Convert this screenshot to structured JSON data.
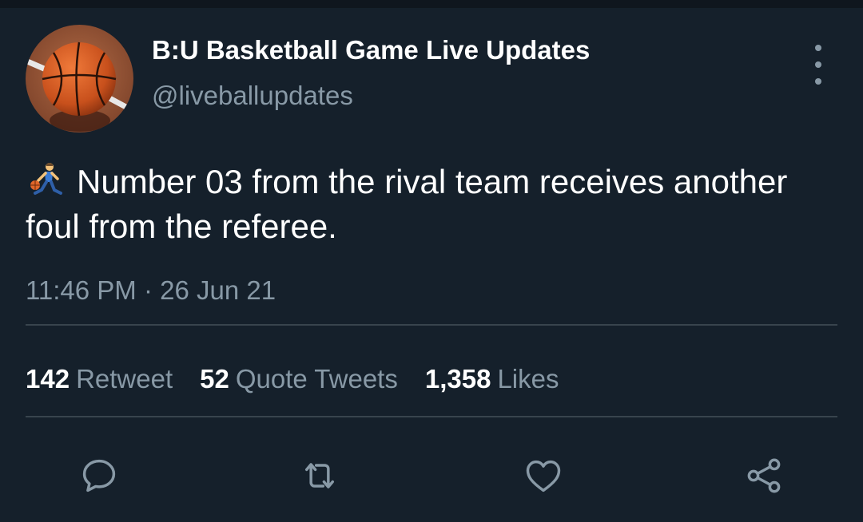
{
  "tweet": {
    "display_name": "B:U Basketball Game Live Updates",
    "handle": "@liveballupdates",
    "emoji_icon": "person-bouncing-ball-icon",
    "text": "Number 03 from the rival team receives another foul from the referee.",
    "timestamp": "11:46 PM · 26 Jun 21"
  },
  "stats": {
    "retweets_count": "142",
    "retweets_label": "Retweet",
    "quotes_count": "52",
    "quotes_label": "Quote Tweets",
    "likes_count": "1,358",
    "likes_label": "Likes"
  },
  "actions": [
    "reply-icon",
    "retweet-icon",
    "like-icon",
    "share-icon"
  ],
  "colors": {
    "background": "#15202b",
    "primary_text": "#ffffff",
    "secondary_text": "#8899a6",
    "divider": "#38444d"
  }
}
